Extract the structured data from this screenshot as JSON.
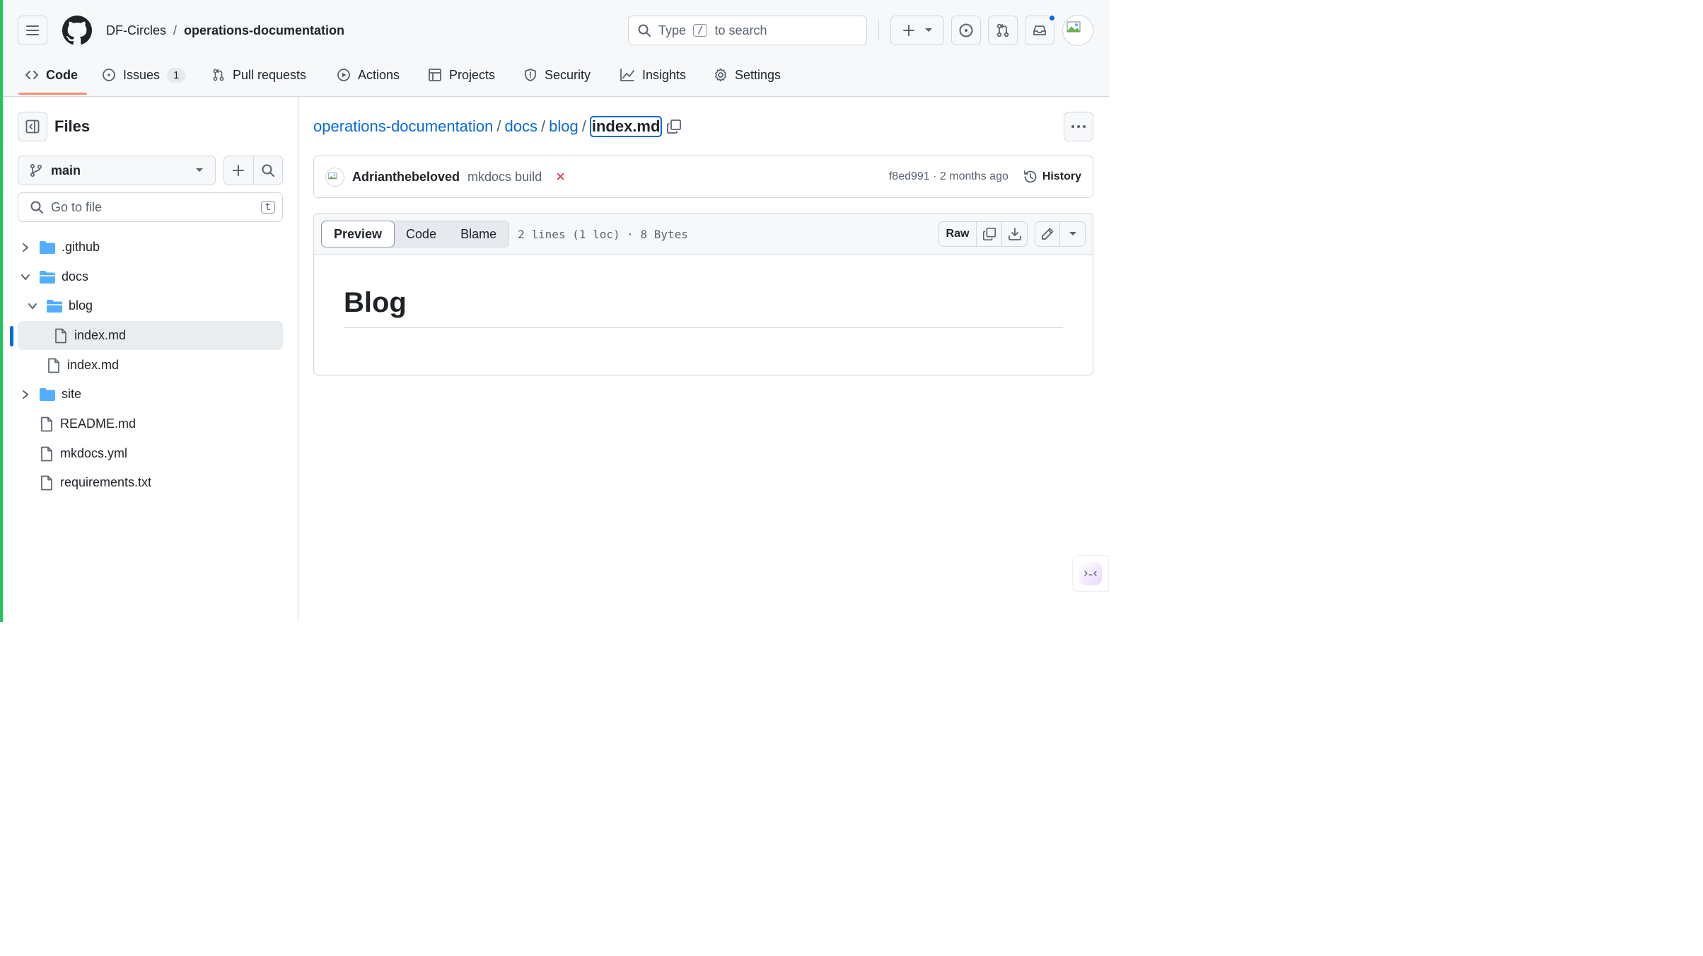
{
  "header": {
    "owner": "DF-Circles",
    "separator": "/",
    "repo": "operations-documentation",
    "search": {
      "prefix": "Type",
      "key": "/",
      "suffix": "to search"
    }
  },
  "nav": {
    "tabs": [
      {
        "label": "Code",
        "icon": "code-icon",
        "active": true
      },
      {
        "label": "Issues",
        "icon": "issue-icon",
        "count": "1"
      },
      {
        "label": "Pull requests",
        "icon": "pull-request-icon"
      },
      {
        "label": "Actions",
        "icon": "play-icon"
      },
      {
        "label": "Projects",
        "icon": "table-icon"
      },
      {
        "label": "Security",
        "icon": "shield-icon"
      },
      {
        "label": "Insights",
        "icon": "graph-icon"
      },
      {
        "label": "Settings",
        "icon": "gear-icon"
      }
    ]
  },
  "sidebar": {
    "title": "Files",
    "branch": "main",
    "goto_placeholder": "Go to file",
    "goto_key": "t",
    "tree": [
      {
        "name": ".github",
        "type": "folder",
        "expanded": false
      },
      {
        "name": "docs",
        "type": "folder",
        "expanded": true
      },
      {
        "name": "blog",
        "type": "folder",
        "expanded": true
      },
      {
        "name": "index.md",
        "type": "file",
        "selected": true
      },
      {
        "name": "index.md",
        "type": "file"
      },
      {
        "name": "site",
        "type": "folder",
        "expanded": false
      },
      {
        "name": "README.md",
        "type": "file"
      },
      {
        "name": "mkdocs.yml",
        "type": "file"
      },
      {
        "name": "requirements.txt",
        "type": "file"
      }
    ]
  },
  "breadcrumb": {
    "repo": "operations-documentation",
    "docs": "docs",
    "blog": "blog",
    "sep": "/",
    "current": "index.md"
  },
  "commit": {
    "author": "Adrianthebeloved",
    "message": "mkdocs build",
    "status": "×",
    "sha_time": "f8ed991 · 2 months ago",
    "history_label": "History"
  },
  "file": {
    "tabs": {
      "preview": "Preview",
      "code": "Code",
      "blame": "Blame"
    },
    "meta": "2 lines (1 loc) · 8 Bytes",
    "raw_label": "Raw",
    "heading": "Blog"
  },
  "colors": {
    "accent": "#0969da",
    "tab_underline": "#fd8c73",
    "folder": "#54aeff",
    "fail": "#cf222e",
    "notification": "#0969da"
  }
}
